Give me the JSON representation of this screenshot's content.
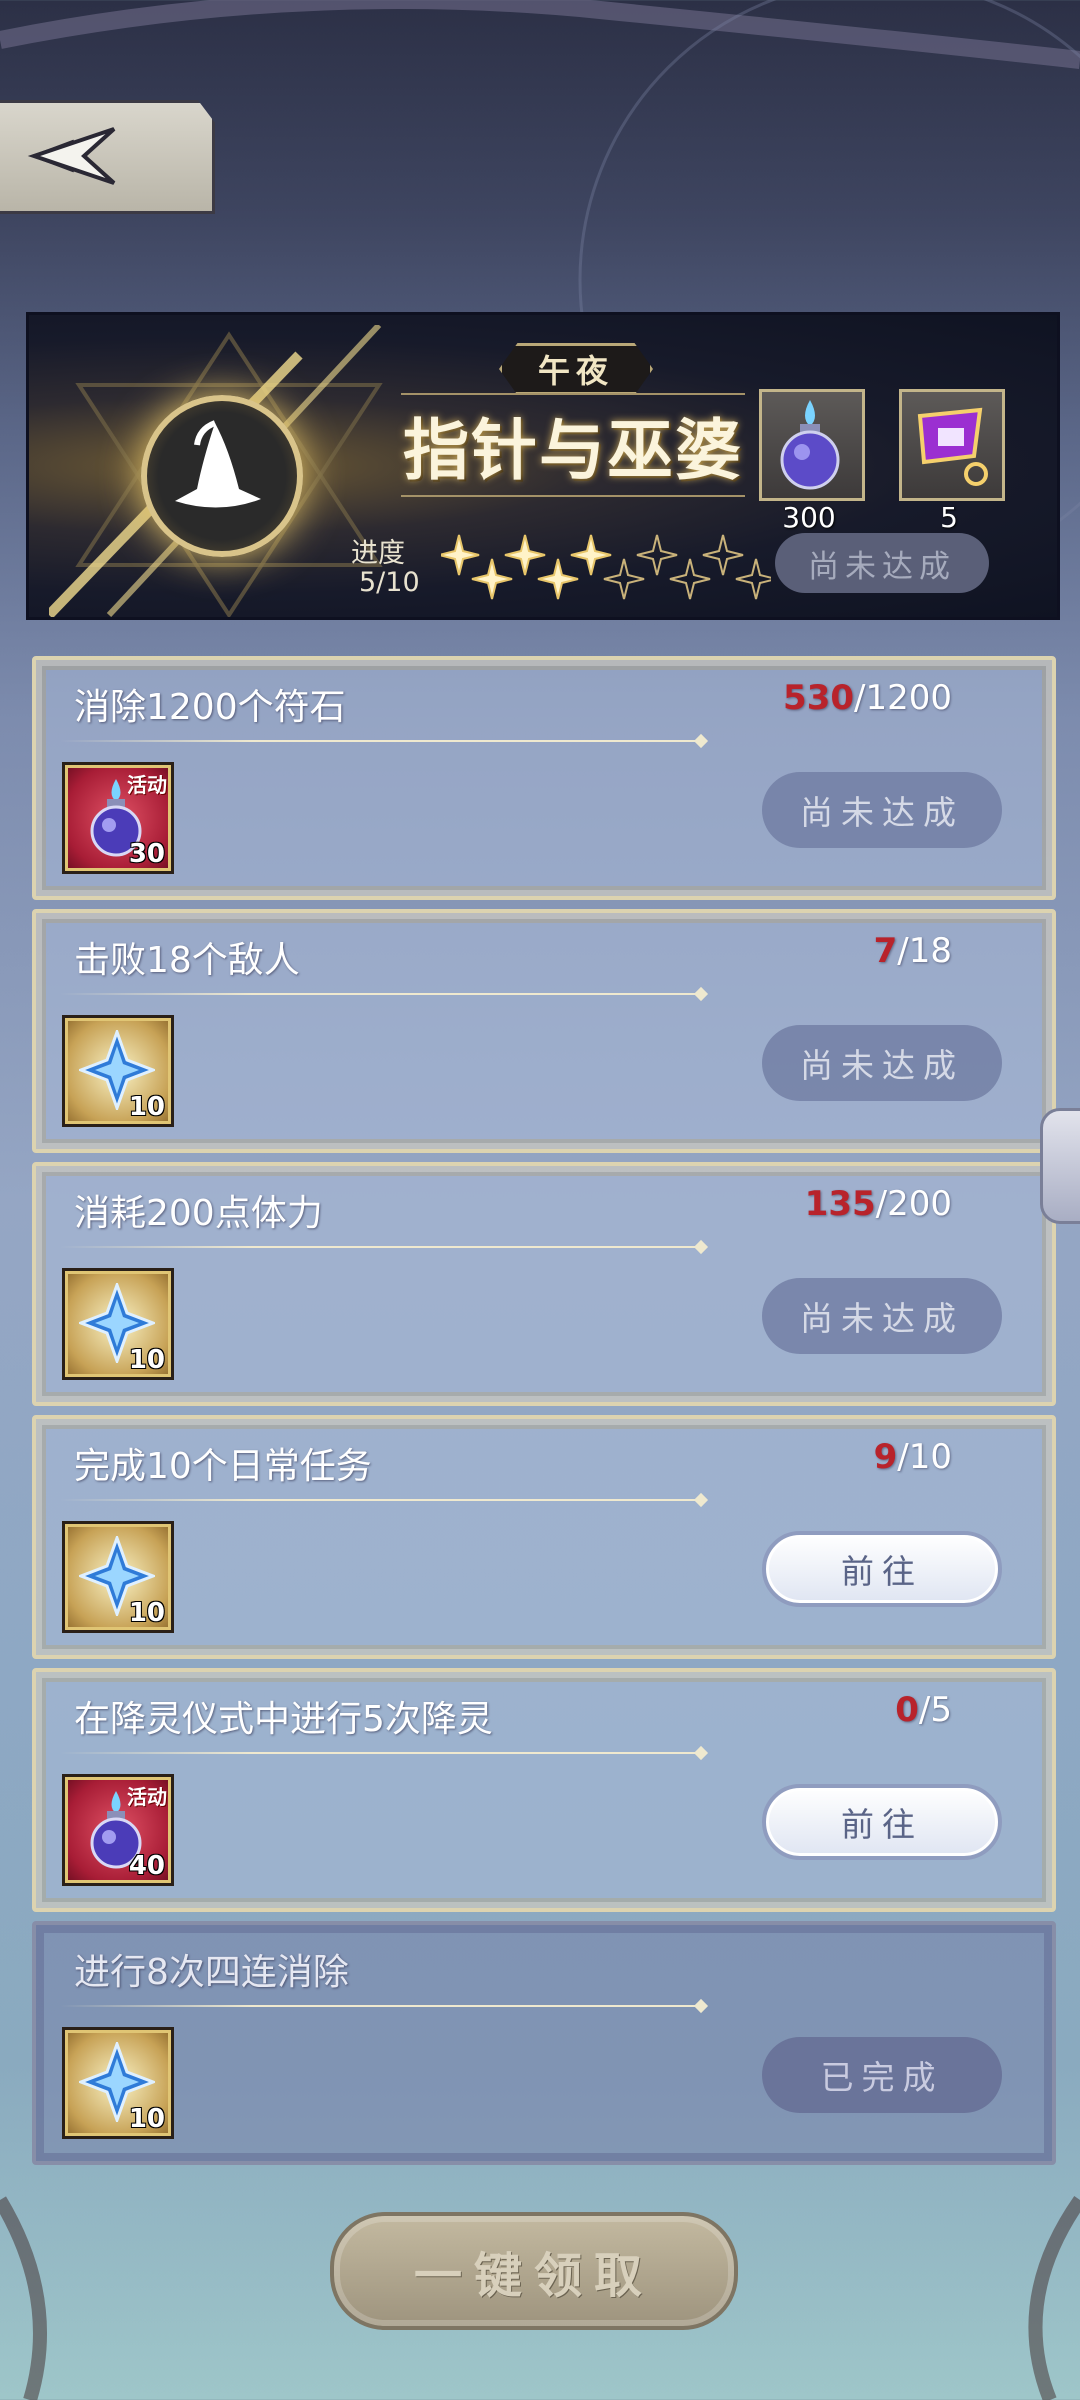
{
  "banner": {
    "subtitle": "午夜",
    "title": "指针与巫婆",
    "progress_label": "进度",
    "progress_value": "5/10",
    "stars_filled": 5,
    "stars_total": 10,
    "rewards": [
      {
        "icon": "blue-potion-icon",
        "count": "300"
      },
      {
        "icon": "purple-gem-icon",
        "count": "5"
      }
    ],
    "status": "尚未达成"
  },
  "tasks": [
    {
      "title": "消除1200个符石",
      "current": "530",
      "total": "/1200",
      "item": {
        "type": "red",
        "icon": "blue-potion-icon",
        "tag": "活动",
        "qty": "30"
      },
      "button": "尚未达成",
      "state": "locked"
    },
    {
      "title": "击败18个敌人",
      "current": "7",
      "total": "/18",
      "item": {
        "type": "gold",
        "icon": "star-crystal-icon",
        "tag": "",
        "qty": "10"
      },
      "button": "尚未达成",
      "state": "locked"
    },
    {
      "title": "消耗200点体力",
      "current": "135",
      "total": "/200",
      "item": {
        "type": "gold",
        "icon": "star-crystal-icon",
        "tag": "",
        "qty": "10"
      },
      "button": "尚未达成",
      "state": "locked"
    },
    {
      "title": "完成10个日常任务",
      "current": "9",
      "total": "/10",
      "item": {
        "type": "gold",
        "icon": "star-crystal-icon",
        "tag": "",
        "qty": "10"
      },
      "button": "前往",
      "state": "go"
    },
    {
      "title": "在降灵仪式中进行5次降灵",
      "current": "0",
      "total": "/5",
      "item": {
        "type": "red",
        "icon": "blue-potion-icon",
        "tag": "活动",
        "qty": "40"
      },
      "button": "前往",
      "state": "go"
    },
    {
      "title": "进行8次四连消除",
      "current": "",
      "total": "",
      "item": {
        "type": "gold",
        "icon": "star-crystal-icon",
        "tag": "",
        "qty": "10"
      },
      "button": "已完成",
      "state": "finished"
    }
  ],
  "claim_all_label": "一键领取",
  "colors": {
    "progress_current": "#b8232b",
    "card_border": "#dcd3b0"
  }
}
